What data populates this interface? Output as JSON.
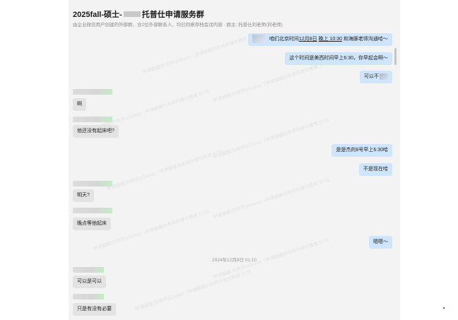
{
  "header": {
    "title_prefix": "2025fall-硕士-",
    "title_suffix": "托普仕申请服务群",
    "subtitle": "由企业微信用户创建的外部群，含2位外部联系人，均已同意存档会话内容 · 群主: 托普仕刘老师(刘老师)"
  },
  "watermark_text": "申请圈圈(刘老师)(Gloria)（申请圈圈刘老师托普仕教育 5779",
  "messages": {
    "m1": {
      "pre": "咱们北京时间",
      "date": "12月8日",
      "mid": " ",
      "time": "晚上 10:30",
      "post": " 和海豚老师沟通哈～"
    },
    "m2": "这个时间是美西时间早上6:30，你早起会啊～",
    "m3": "可以不",
    "m4": "啊",
    "m5": "他还没有起床吧?",
    "m6": "是是杰的8号早上6:30哈",
    "m7": "不是现在哈",
    "m8": "明天?",
    "m9": "晚点等他起床",
    "m10": "嗯嗯～",
    "timestamp": "2024年12月8日 01:10",
    "m11": "可以是可以",
    "m12": "只是有没有必要"
  }
}
